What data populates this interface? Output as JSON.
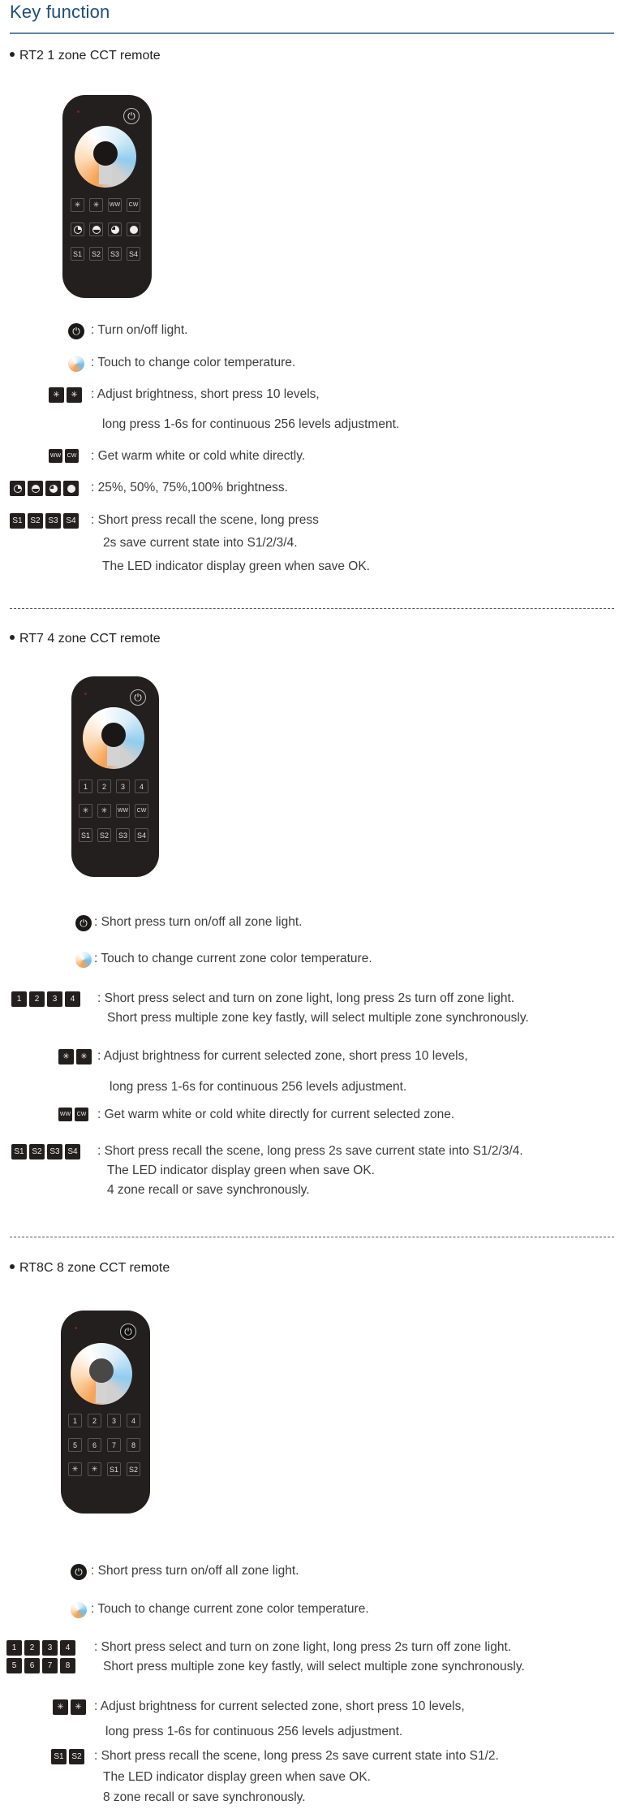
{
  "page": {
    "title": "Key function"
  },
  "sections": [
    {
      "heading": "RT2  1 zone CCT remote",
      "remote": {
        "rows": [
          [
            "*-",
            "*+",
            "WW",
            "CW"
          ],
          [
            "25%",
            "50%",
            "75%",
            "100%"
          ],
          [
            "S1",
            "S2",
            "S3",
            "S4"
          ]
        ]
      },
      "items": [
        {
          "icons": [
            "power"
          ],
          "lines": [
            ": Turn on/off light."
          ]
        },
        {
          "icons": [
            "color-wheel"
          ],
          "lines": [
            ": Touch to change color temperature."
          ]
        },
        {
          "icons": [
            "brightness-down",
            "brightness-up"
          ],
          "lines": [
            ": Adjust brightness, short press 10 levels,",
            "long press 1-6s for continuous 256 levels adjustment."
          ]
        },
        {
          "icons": [
            "ww",
            "cw"
          ],
          "labels": [
            "WW",
            "CW"
          ],
          "lines": [
            ": Get warm white or cold white directly."
          ]
        },
        {
          "icons": [
            "25%",
            "50%",
            "75%",
            "100%"
          ],
          "lines": [
            ": 25%, 50%, 75%,100% brightness."
          ]
        },
        {
          "icons": [
            "S1",
            "S2",
            "S3",
            "S4"
          ],
          "labels": [
            "S1",
            "S2",
            "S3",
            "S4"
          ],
          "lines": [
            ": Short press recall the scene, long press",
            "2s save current state into S1/2/3/4.",
            "The LED indicator display green when save OK."
          ]
        }
      ]
    },
    {
      "heading": "RT7  4 zone CCT remote",
      "remote": {
        "rows": [
          [
            "1",
            "2",
            "3",
            "4"
          ],
          [
            "*-",
            "*+",
            "WW",
            "CW"
          ],
          [
            "S1",
            "S2",
            "S3",
            "S4"
          ]
        ]
      },
      "items": [
        {
          "icons": [
            "power"
          ],
          "lines": [
            ": Short press turn on/off all zone light."
          ]
        },
        {
          "icons": [
            "color-wheel"
          ],
          "lines": [
            ": Touch to change current zone color temperature."
          ]
        },
        {
          "icons": [
            "1",
            "2",
            "3",
            "4"
          ],
          "labels": [
            "1",
            "2",
            "3",
            "4"
          ],
          "lines": [
            ": Short press select and turn on zone light, long press 2s turn off zone light.",
            "Short press multiple zone key fastly, will select multiple zone synchronously."
          ]
        },
        {
          "icons": [
            "brightness-down",
            "brightness-up"
          ],
          "lines": [
            ": Adjust brightness for current selected zone, short press 10 levels,",
            "long press 1-6s for continuous  256 levels adjustment."
          ]
        },
        {
          "icons": [
            "ww",
            "cw"
          ],
          "labels": [
            "WW",
            "CW"
          ],
          "lines": [
            ": Get warm white or cold white directly for current selected zone."
          ]
        },
        {
          "icons": [
            "S1",
            "S2",
            "S3",
            "S4"
          ],
          "labels": [
            "S1",
            "S2",
            "S3",
            "S4"
          ],
          "lines": [
            ": Short press recall the scene, long press 2s save current state into S1/2/3/4.",
            "The LED indicator display green when save OK.",
            "4 zone recall or save synchronously."
          ]
        }
      ]
    },
    {
      "heading": "RT8C  8 zone CCT remote",
      "remote": {
        "rows": [
          [
            "1",
            "2",
            "3",
            "4"
          ],
          [
            "5",
            "6",
            "7",
            "8"
          ],
          [
            "*-",
            "*+",
            "S1",
            "S2"
          ]
        ]
      },
      "items": [
        {
          "icons": [
            "power"
          ],
          "lines": [
            ": Short press turn on/off all zone light."
          ]
        },
        {
          "icons": [
            "color-wheel"
          ],
          "lines": [
            ": Touch to change current zone color temperature."
          ]
        },
        {
          "icons": [
            "1",
            "2",
            "3",
            "4",
            "5",
            "6",
            "7",
            "8"
          ],
          "labels": [
            "1",
            "2",
            "3",
            "4",
            "5",
            "6",
            "7",
            "8"
          ],
          "lines": [
            ": Short press select and turn on zone light, long press 2s turn off zone light.",
            "Short press multiple zone key fastly, will select multiple zone synchronously."
          ]
        },
        {
          "icons": [
            "brightness-down",
            "brightness-up"
          ],
          "lines": [
            ": Adjust brightness for current selected zone, short press 10 levels,",
            "long press 1-6s for continuous  256 levels adjustment."
          ]
        },
        {
          "icons": [
            "S1",
            "S2"
          ],
          "labels": [
            "S1",
            "S2"
          ],
          "lines": [
            ": Short press recall the scene, long press 2s save current state into S1/2.",
            "The LED indicator display green when save OK.",
            "8 zone recall or save synchronously."
          ]
        }
      ]
    }
  ],
  "colors": {
    "title": "#1f4e79",
    "rule": "#5d87a1",
    "remote_body": "#231f1e",
    "warm": "#f6a253",
    "cold": "#8fcdef"
  }
}
